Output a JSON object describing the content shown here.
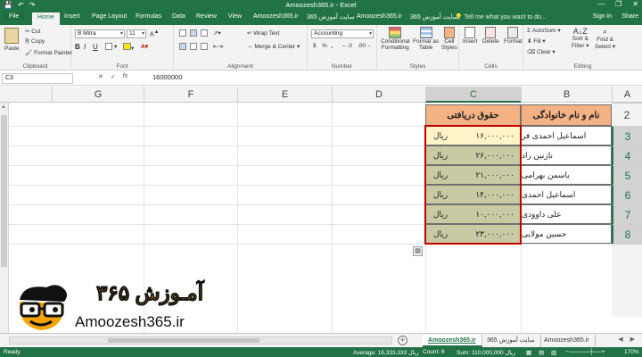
{
  "window": {
    "title": "Amoozesh365.ir - Excel",
    "minimize": "—",
    "restore": "❐",
    "close": "✕"
  },
  "qat": {
    "save": "💾",
    "undo": "↶",
    "redo": "↷"
  },
  "tabs": [
    "File",
    "Home",
    "Insert",
    "Page Layout",
    "Formulas",
    "Data",
    "Review",
    "View",
    "Amoozesh365.ir",
    "سایت آموزش 365",
    "Amoozesh365.ir",
    "سایت آموزش 365"
  ],
  "tell_me": "Tell me what you want to do...",
  "sign_in": "Sign in",
  "share": "Share",
  "ribbon": {
    "clipboard": {
      "paste": "Paste",
      "cut": "Cut",
      "copy": "Copy",
      "format_painter": "Format Painter",
      "label": "Clipboard"
    },
    "font": {
      "name": "B Mitra",
      "size": "11",
      "bold": "B",
      "italic": "I",
      "underline": "U",
      "label": "Font"
    },
    "alignment": {
      "wrap_text": "Wrap Text",
      "merge_center": "Merge & Center",
      "label": "Alignment"
    },
    "number": {
      "format": "Accounting",
      "currency": "$",
      "percent": "%",
      "comma": ",",
      "label": "Number"
    },
    "styles": {
      "conditional": "Conditional",
      "conditional2": "Formatting",
      "format_as": "Format as",
      "table": "Table",
      "cell": "Cell",
      "styles2": "Styles",
      "label": "Styles"
    },
    "cells": {
      "insert": "Insert",
      "delete": "Delete",
      "format": "Format",
      "label": "Cells"
    },
    "editing": {
      "autosum": "AutoSum",
      "fill": "Fill",
      "clear": "Clear",
      "sort": "Sort &",
      "filter": "Filter",
      "find": "Find &",
      "select": "Select",
      "label": "Editing"
    }
  },
  "formula_bar": {
    "name_box": "C3",
    "cancel": "✕",
    "enter": "✓",
    "fx": "fx",
    "value": "16000000"
  },
  "columns": [
    "A",
    "B",
    "C",
    "D",
    "E",
    "F",
    "G"
  ],
  "rows": [
    "2",
    "3",
    "4",
    "5",
    "6",
    "7",
    "8"
  ],
  "table": {
    "header_name": "نام و نام خانوادگی",
    "header_salary": "حقوق دریافتی",
    "rows": [
      {
        "name": "اسماعیل احمدی فر",
        "amount": "۱۶,۰۰۰,۰۰۰",
        "unit": "ریال"
      },
      {
        "name": "نازنین راد",
        "amount": "۲۶,۰۰۰,۰۰۰",
        "unit": "ریال"
      },
      {
        "name": "یاسمن بهرامی",
        "amount": "۲۱,۰۰۰,۰۰۰",
        "unit": "ریال"
      },
      {
        "name": "اسماعیل احمدی",
        "amount": "۱۴,۰۰۰,۰۰۰",
        "unit": "ریال"
      },
      {
        "name": "علی داوودی",
        "amount": "۱۰,۰۰۰,۰۰۰",
        "unit": "ریال"
      },
      {
        "name": "حسین مولایی",
        "amount": "۲۳,۰۰۰,۰۰۰",
        "unit": "ریال"
      }
    ]
  },
  "logo": {
    "persian": "آمـوزش ۳۶۵",
    "brand": "Amoozesh365.ir"
  },
  "sheet_tabs": [
    "Amoozesh365.ir",
    "سایت آموزش 365",
    "Amoozesh365.ir"
  ],
  "add_sheet": "+",
  "status": {
    "ready": "Ready",
    "average": "Average: 18,333,333 ریال",
    "count": "Count: 6",
    "sum": "Sum: 110,000,000 ریال",
    "zoom": "170%"
  }
}
